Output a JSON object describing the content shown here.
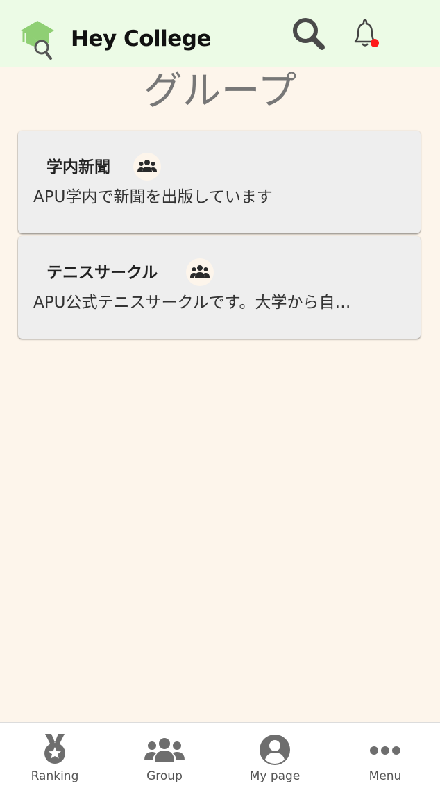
{
  "header": {
    "app_title": "Hey College",
    "notification_dot_color": "#ff1a1a"
  },
  "page": {
    "title": "グループ"
  },
  "groups": [
    {
      "name": "学内新聞",
      "description": "APU学内で新聞を出版しています",
      "icon": "group-icon"
    },
    {
      "name": "テニスサークル",
      "description": "APU公式テニスサークルです。大学から自…",
      "icon": "group-icon"
    }
  ],
  "bottom_nav": [
    {
      "label": "Ranking",
      "icon": "medal-icon"
    },
    {
      "label": "Group",
      "icon": "group-icon"
    },
    {
      "label": "My page",
      "icon": "user-circle-icon"
    },
    {
      "label": "Menu",
      "icon": "more-dots-icon"
    }
  ],
  "colors": {
    "header_bg": "#ecfbe6",
    "page_bg": "#fdf5eb",
    "card_bg": "#eeeeee",
    "logo_green": "#8fcf74"
  }
}
